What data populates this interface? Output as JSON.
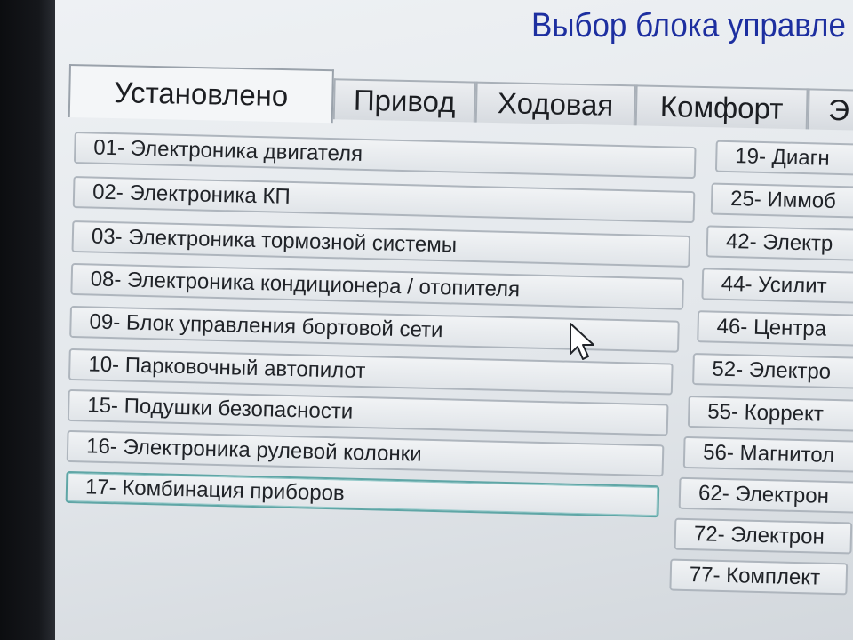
{
  "window": {
    "title": "Выбор блока управле"
  },
  "tabs": [
    {
      "label": "Установлено",
      "active": true
    },
    {
      "label": "Привод"
    },
    {
      "label": "Ходовая"
    },
    {
      "label": "Комфорт"
    },
    {
      "label": "Э"
    }
  ],
  "left_units": [
    "01- Электроника двигателя",
    "02- Электроника КП",
    "03- Электроника тормозной системы",
    "08- Электроника кондиционера / отопителя",
    "09- Блок управления бортовой сети",
    "10- Парковочный автопилот",
    "15- Подушки безопасности",
    "16- Электроника рулевой колонки",
    "17- Комбинация приборов"
  ],
  "right_units": [
    "19- Диагн",
    "25- Иммоб",
    "42- Электр",
    "44- Усилит",
    "46- Центра",
    "52- Электро",
    "55- Коррект",
    "56- Магнитол",
    "62- Электрон",
    "72- Электрон",
    "77- Комплект"
  ],
  "focused_unit": "17- Комбинация приборов",
  "colors": {
    "title": "#1d2fa0",
    "focus_border": "#5fa6a6"
  },
  "icons": {
    "cursor": "mouse-pointer-icon"
  }
}
